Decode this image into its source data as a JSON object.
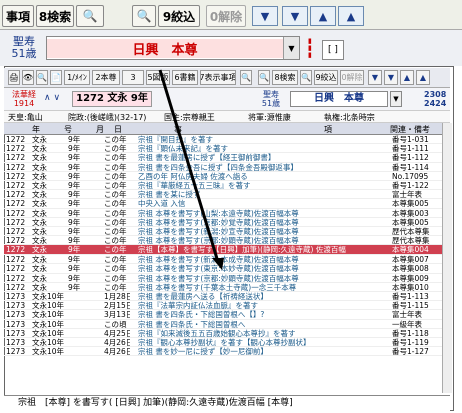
{
  "toolbar": {
    "items": [
      {
        "label": "事項",
        "disabled": false
      },
      {
        "label": "8検索",
        "disabled": false
      },
      {
        "label": "🔍",
        "disabled": false
      },
      {
        "label": "🔍",
        "disabled": false
      },
      {
        "label": "9絞込",
        "disabled": false
      },
      {
        "label": "0解除",
        "disabled": true
      }
    ],
    "nav": [
      "▼̲",
      "▼",
      "▲",
      "▲̄"
    ]
  },
  "header": {
    "age_label": "聖寿",
    "age_value": "51歳",
    "selected": "日興　本尊"
  },
  "sub": {
    "buttons": [
      "🖨",
      "👁",
      "🔍",
      "📄",
      "1/ﾒｲﾝ",
      "2本尊",
      "3 ",
      "5図版",
      "6書籍",
      "7表示事項",
      "🔍",
      "🔍",
      "8検索",
      "🔍",
      "9絞込",
      "0解除"
    ],
    "era": "法華経",
    "era_year": "1914",
    "year": "1272 文永 9年",
    "age_label": "聖寿",
    "age_value": "51歳",
    "bname": "日興　本尊",
    "num1": "2308",
    "num2": "2424"
  },
  "info": {
    "emperor": "天皇:亀山",
    "shogun": "院政:(後嵯峨)(32-17)",
    "regent": "国主:宗尊親王",
    "general": "将軍:源惟康",
    "shikken": "執権:北条時宗"
  },
  "table": {
    "headers": [
      "年",
      "号",
      "月",
      "日",
      "事",
      "項",
      "関連・備考"
    ],
    "rows": [
      [
        "1272",
        "文永",
        "9年",
        "この年",
        "宗祖『開目抄』を著す",
        "番号1-031"
      ],
      [
        "1272",
        "文永",
        "9年",
        "この年",
        "宗祖『顕仏未来記』を著す",
        "番号1-111"
      ],
      [
        "1272",
        "文永",
        "9年",
        "この年",
        "宗祖 書を最蓮房に授ず【経王御前御書】",
        "番号1-112"
      ],
      [
        "1272",
        "文永",
        "9年",
        "この年",
        "宗祖 書を四条金吾に授ず【四条金吾殿御返事】",
        "番号1-114"
      ],
      [
        "1272",
        "文永",
        "9年",
        "この年",
        "乙酉の年 阿仏房夫婦 佐渡へ詣る",
        "No.17095"
      ],
      [
        "1272",
        "文永",
        "9年",
        "この年",
        "宗祖『華厳経五十五三昧』を著す",
        "番号1-122"
      ],
      [
        "1272",
        "文永",
        "9年",
        "この年",
        "宗祖 書を某に授ず",
        "富士年表"
      ],
      [
        "1272",
        "文永",
        "9年",
        "この年",
        "中央入道 入信",
        "本尊集005"
      ],
      [
        "1272",
        "文永",
        "9年",
        "この年",
        "宗祖 本尊を書写す(山梨:本遠寺蔵)佐渡百幅本尊",
        "本尊集003"
      ],
      [
        "1272",
        "文永",
        "9年",
        "この年",
        "宗祖 本尊を書写す(京都:妙覚寺蔵)佐渡百幅本尊",
        "本尊集005"
      ],
      [
        "1272",
        "文永",
        "9年",
        "この年",
        "宗祖 本尊を書写す(新潟:妙宣寺蔵)佐渡百幅本尊",
        "歴代本尊集"
      ],
      [
        "1272",
        "文永",
        "9年",
        "この年",
        "宗祖 本尊を書写す(京都:妙顕寺蔵)佐渡百幅本尊",
        "歴代本尊集"
      ],
      [
        "1272",
        "文永",
        "9年",
        "この年",
        "宗祖【本尊】を書写す(【日興】加筆)(静岡:久遠寺蔵) 佐渡百幅",
        "本尊集004"
      ],
      [
        "1272",
        "文永",
        "9年",
        "この年",
        "宗祖 本尊を書写す(新潟:本成寺蔵)佐渡百幅本尊",
        "本尊集007"
      ],
      [
        "1272",
        "文永",
        "9年",
        "この年",
        "宗祖 本尊を書写す(東京:本妙寺蔵)佐渡百幅本尊",
        "本尊集008"
      ],
      [
        "1272",
        "文永",
        "9年",
        "この年",
        "宗祖 本尊を書写す(京都:妙顕寺蔵)佐渡百幅本尊",
        "本尊集009"
      ],
      [
        "1272",
        "文永",
        "9年",
        "この年",
        "宗祖 本尊を書写す(千葉本土寺蔵)一念三千本尊",
        "本尊集010"
      ],
      [
        "1273",
        "文永10年",
        "",
        "1月28日",
        "宗祖 書を最蓮房へ送る【祈祷経送状】",
        "番号1-113"
      ],
      [
        "1273",
        "文永10年",
        "",
        "2月15日",
        "宗祖『法華宗内証仏法血脈』を著す",
        "番号1-115"
      ],
      [
        "1273",
        "文永10年",
        "",
        "3月13日",
        "宗祖 書を四条氏・下総国曽根へ【】?",
        "富士年表"
      ],
      [
        "1273",
        "文永10年",
        "",
        "この頃",
        "宗祖 書を四条氏・下総国曽根へ",
        "一級年表"
      ],
      [
        "1273",
        "文永10年",
        "",
        "4月25日",
        "宗祖『如来滅後五五百歳始観心本尊抄』を著す",
        "番号1-118"
      ],
      [
        "1273",
        "文永10年",
        "",
        "4月26日",
        "宗祖『観心本尊抄副状』を著す【観心本尊抄副状】",
        "番号1-119"
      ],
      [
        "1273",
        "文永10年",
        "",
        "4月26日",
        "宗祖 書を妙一尼に授ず【妙一尼御前】",
        "番号1-127"
      ]
    ],
    "highlight": 12
  },
  "status": {
    "text": "宗祖　[本尊] を書写す( [日興] 加筆)(静岡:久遠寺蔵)佐渡百幅 [本尊]"
  }
}
